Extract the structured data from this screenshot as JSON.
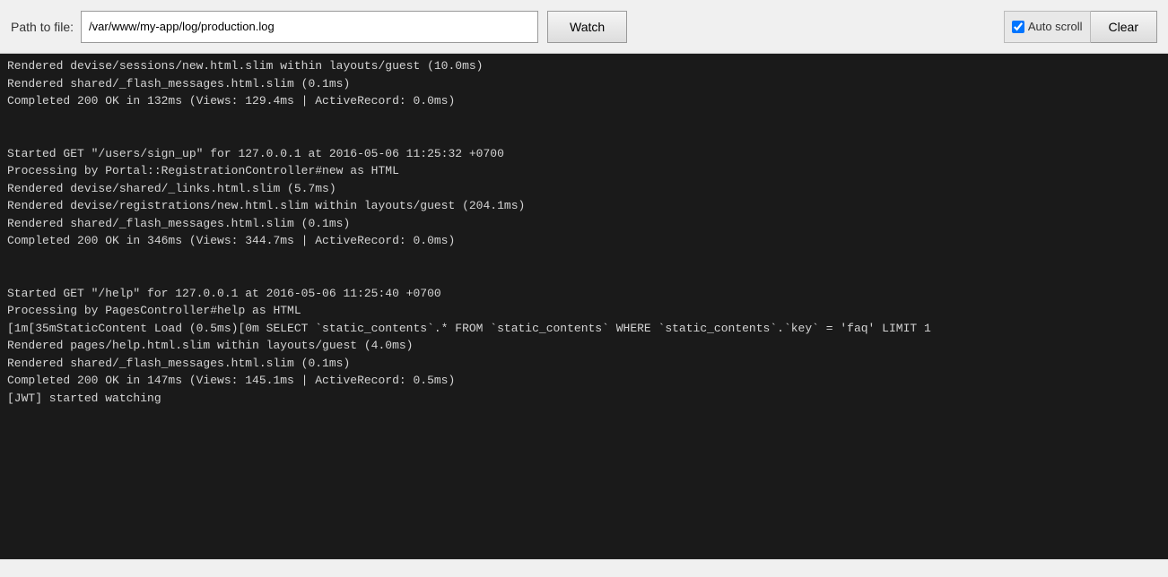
{
  "toolbar": {
    "path_label": "Path to file:",
    "path_value": "/var/www/my-app/log/production.log",
    "path_placeholder": "/var/www/my-app/log/production.log",
    "watch_label": "Watch",
    "auto_scroll_label": "Auto scroll",
    "clear_label": "Clear"
  },
  "log": {
    "lines": [
      "Rendered devise/sessions/new.html.slim within layouts/guest (10.0ms)",
      "Rendered shared/_flash_messages.html.slim (0.1ms)",
      "Completed 200 OK in 132ms (Views: 129.4ms | ActiveRecord: 0.0ms)",
      "",
      "",
      "Started GET \"/users/sign_up\" for 127.0.0.1 at 2016-05-06 11:25:32 +0700",
      "Processing by Portal::RegistrationController#new as HTML",
      "Rendered devise/shared/_links.html.slim (5.7ms)",
      "Rendered devise/registrations/new.html.slim within layouts/guest (204.1ms)",
      "Rendered shared/_flash_messages.html.slim (0.1ms)",
      "Completed 200 OK in 346ms (Views: 344.7ms | ActiveRecord: 0.0ms)",
      "",
      "",
      "Started GET \"/help\" for 127.0.0.1 at 2016-05-06 11:25:40 +0700",
      "Processing by PagesController#help as HTML",
      "[1m[35mStaticContent Load (0.5ms)[0m SELECT `static_contents`.* FROM `static_contents` WHERE `static_contents`.`key` = 'faq' LIMIT 1",
      "Rendered pages/help.html.slim within layouts/guest (4.0ms)",
      "Rendered shared/_flash_messages.html.slim (0.1ms)",
      "Completed 200 OK in 147ms (Views: 145.1ms | ActiveRecord: 0.5ms)",
      "[JWT] started watching"
    ]
  }
}
